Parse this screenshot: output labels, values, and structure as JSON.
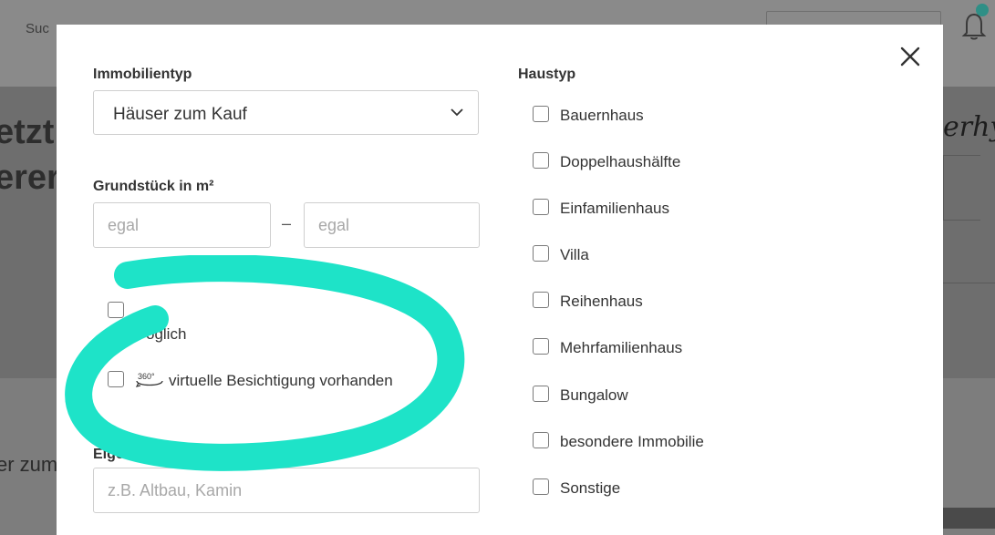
{
  "background": {
    "top_text": "Suc",
    "hero_title_line1": "etzt",
    "hero_title_line2": "erer",
    "brand_fragment": "erhy",
    "lower_text": "er zum"
  },
  "modal": {
    "property_type": {
      "label": "Immobilientyp",
      "selected": "Häuser zum Kauf"
    },
    "plot_size": {
      "label": "Grundstück in m²",
      "min_placeholder": "egal",
      "separator": "–",
      "max_placeholder": "egal"
    },
    "hidden_option": {
      "label_fragment": "öglich"
    },
    "virtual_tour": {
      "icon_text": "360°",
      "label": "virtuelle Besichtigung vorhanden"
    },
    "features": {
      "label_fragment": "Eige",
      "placeholder": "z.B. Altbau, Kamin"
    },
    "house_type": {
      "label": "Haustyp",
      "options": [
        {
          "label": "Bauernhaus",
          "checked": false
        },
        {
          "label": "Doppelhaushälfte",
          "checked": false
        },
        {
          "label": "Einfamilienhaus",
          "checked": false
        },
        {
          "label": "Villa",
          "checked": false
        },
        {
          "label": "Reihenhaus",
          "checked": false
        },
        {
          "label": "Mehrfamilienhaus",
          "checked": false
        },
        {
          "label": "Bungalow",
          "checked": false
        },
        {
          "label": "besondere Immobilie",
          "checked": false
        },
        {
          "label": "Sonstige",
          "checked": false
        }
      ]
    }
  },
  "colors": {
    "highlight": "#1ee3c8",
    "overlay": "#7d7d7d",
    "accent": "#2f8f86"
  }
}
